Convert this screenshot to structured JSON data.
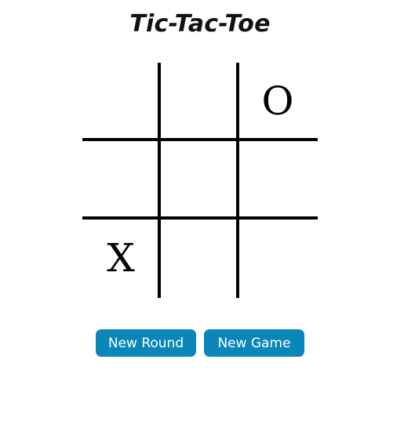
{
  "title": "Tic-Tac-Toe",
  "board": {
    "cells": [
      "",
      "",
      "O",
      "",
      "",
      "",
      "X",
      "",
      ""
    ]
  },
  "buttons": {
    "new_round": "New Round",
    "new_game": "New Game"
  },
  "colors": {
    "button_bg": "#0a87b8",
    "button_text": "#ffffff",
    "grid_line": "#000000"
  }
}
